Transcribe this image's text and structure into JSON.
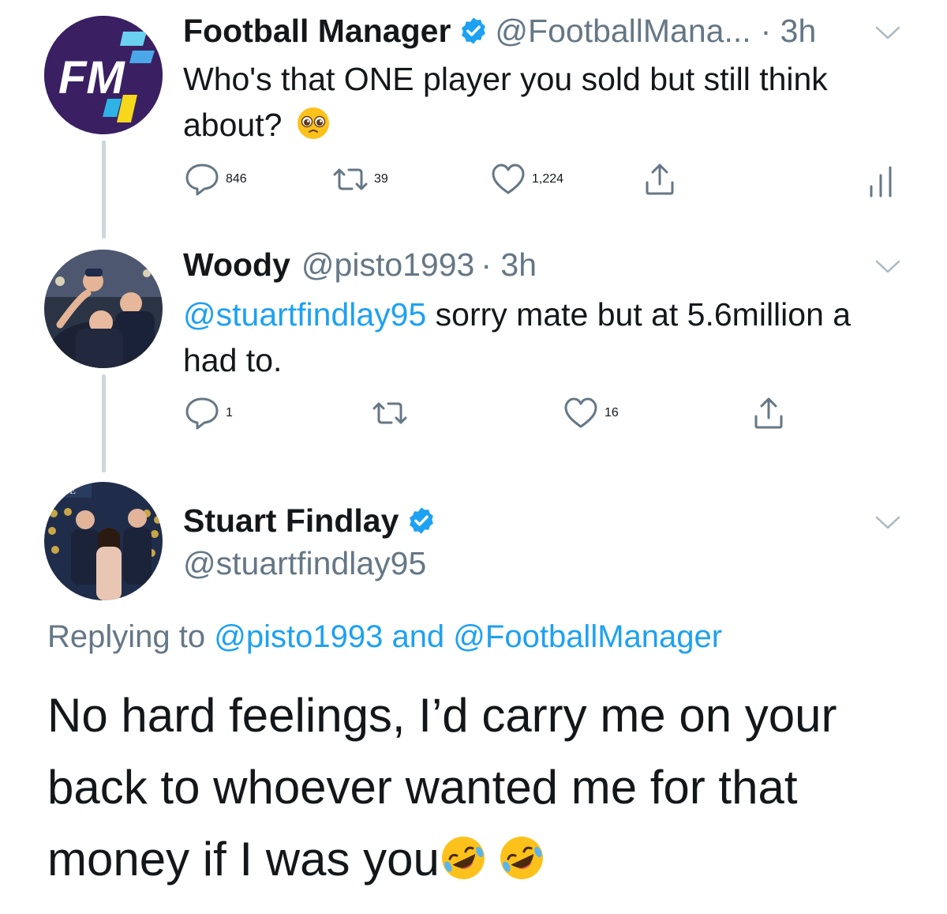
{
  "colors": {
    "accent": "#1da1f2",
    "muted": "#657786",
    "thread_line": "#ccd6dd",
    "fm_purple": "#3a2062"
  },
  "tweets": [
    {
      "display_name": "Football Manager",
      "verified": true,
      "handle": "@FootballMana...",
      "time": "· 3h",
      "text": "Who's that ONE player you sold but still think about?",
      "emoji": "pleading-face",
      "avatar_text": "FM",
      "actions": {
        "replies": "846",
        "retweets": "39",
        "likes": "1,224"
      }
    },
    {
      "display_name": "Woody",
      "handle": "@pisto1993",
      "time": "· 3h",
      "mention": "@stuartfindlay95",
      "text": " sorry mate but at 5.6million a had to.",
      "actions": {
        "replies": "1",
        "retweets": "",
        "likes": "16"
      }
    }
  ],
  "main_tweet": {
    "display_name": "Stuart Findlay",
    "verified": true,
    "handle": "@stuartfindlay95",
    "avatar_sign": "UCTE",
    "replying_prefix": "Replying to ",
    "replying_user1": "@pisto1993",
    "replying_and": " and ",
    "replying_user2": "@FootballManager",
    "text": "No hard feelings, I’d carry me on your back to whoever wanted me for that money if I was you",
    "emoji": "rolling-on-floor-laughing"
  }
}
